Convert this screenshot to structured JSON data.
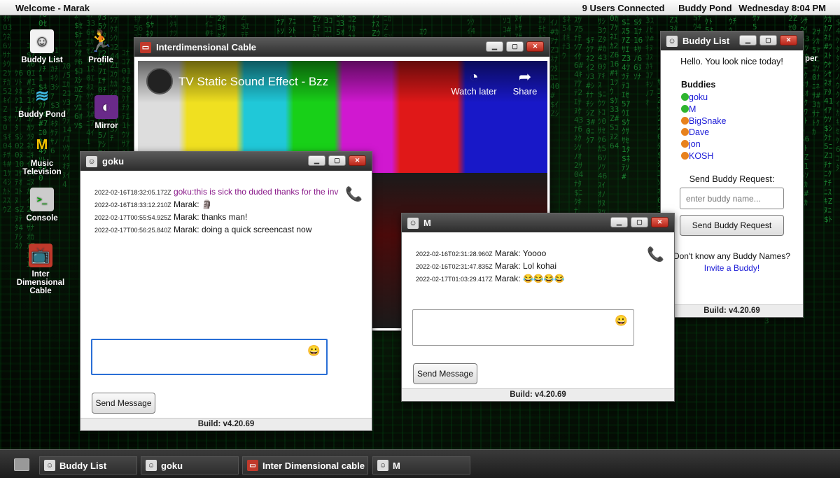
{
  "topbar": {
    "welcome": "Welcome - Marak",
    "users_connected": "9 Users Connected",
    "app_name": "Buddy Pond",
    "datetime": "Wednesday 8:04 PM"
  },
  "desktop_icons": [
    {
      "label": "Buddy List",
      "icon": "buddy-list-icon"
    },
    {
      "label": "Profile",
      "icon": "profile-icon"
    },
    {
      "label": "Buddy Pond",
      "icon": "pond-icon"
    },
    {
      "label": "Mirror",
      "icon": "mirror-icon"
    },
    {
      "label": "Music\nTelevision",
      "label_1": "Music",
      "label_2": "Television",
      "icon": "mtv-icon"
    },
    {
      "label": "Console",
      "icon": "console-icon"
    },
    {
      "label_1": "Inter",
      "label_2": "Dimensional",
      "label_3": "Cable",
      "icon": "tv-icon"
    }
  ],
  "cable_window": {
    "title": "Interdimensional Cable",
    "video_title": "TV Static Sound Effect - Bzz",
    "watch_later": "Watch later",
    "share": "Share"
  },
  "buddy_list_window": {
    "title": "Buddy List",
    "greeting": "Hello. You look nice today!",
    "buddies_heading": "Buddies",
    "buddies": [
      {
        "name": "goku",
        "status_color": "#2fb52f"
      },
      {
        "name": "M",
        "status_color": "#2fb52f"
      },
      {
        "name": "BigSnake",
        "status_color": "#e8821e"
      },
      {
        "name": "Dave",
        "status_color": "#e8821e"
      },
      {
        "name": "jon",
        "status_color": "#e8821e"
      },
      {
        "name": "KOSH",
        "status_color": "#e8821e"
      }
    ],
    "request_label": "Send Buddy Request:",
    "request_placeholder": "enter buddy name...",
    "request_button": "Send Buddy Request",
    "dont_know": "Don't know any Buddy Names?",
    "invite_link": "Invite a Buddy!",
    "build": "Build: v4.20.69",
    "partial_desktop_label": "per"
  },
  "goku_window": {
    "title": "goku",
    "messages": [
      {
        "ts": "2022-02-16T18:32:05.172Z",
        "text": "goku:this is sick tho duded thanks for the inv"
      },
      {
        "ts": "2022-02-16T18:33:12.210Z",
        "text": "Marak: 🗿"
      },
      {
        "ts": "2022-02-17T00:55:54.925Z",
        "text": "Marak: thanks man!"
      },
      {
        "ts": "2022-02-17T00:56:25.840Z",
        "text": "Marak: doing a quick screencast now"
      }
    ],
    "send_button": "Send Message",
    "build": "Build: v4.20.69"
  },
  "m_window": {
    "title": "M",
    "messages": [
      {
        "ts": "2022-02-16T02:31:28.960Z",
        "text": "Marak: Yoooo"
      },
      {
        "ts": "2022-02-16T02:31:47.835Z",
        "text": "Marak: Lol kohai"
      },
      {
        "ts": "2022-02-17T01:03:29.417Z",
        "text": "Marak: 😂😂😂😂"
      }
    ],
    "send_button": "Send Message",
    "build": "Build: v4.20.69"
  },
  "taskbar": {
    "items": [
      {
        "label": "Buddy List"
      },
      {
        "label": "goku"
      },
      {
        "label": "Inter Dimensional cable"
      },
      {
        "label": "M"
      }
    ]
  },
  "colors": {
    "online": "#2fb52f",
    "away": "#e8821e",
    "link": "#1a1ad6",
    "focus": "#2a6fd6"
  }
}
